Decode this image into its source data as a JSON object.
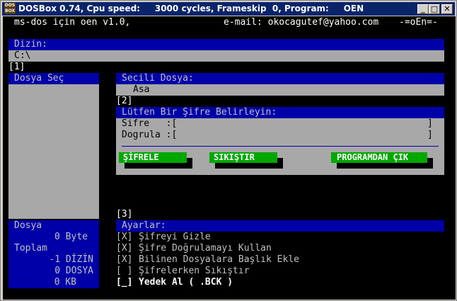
{
  "window": {
    "title": "DOSBox 0.74, Cpu speed:     3000 cycles, Frameskip  0, Program:     OEN",
    "icon_text": "DOS BOX",
    "minimize": "_",
    "maximize": "□",
    "close": "✕"
  },
  "header": {
    "app": "ms-dos için oen v1.0,",
    "email": "e-mail: okocagutef@yahoo.com",
    "logo": "-=oEn=-"
  },
  "dir": {
    "label": "Dizin:",
    "path": "C:\\",
    "index": "[1]"
  },
  "file_select": {
    "label": "Dosya Seç"
  },
  "selected": {
    "label": "Secili Dosya:",
    "name": "Asa",
    "index": "[2]"
  },
  "password": {
    "label": "Lütfen Bir Şifre Belirleyin:",
    "pass_label": "Sifre   :[",
    "confirm_label": "Dogrula :[",
    "bracket_close": "]"
  },
  "buttons": {
    "encrypt": "ŞİFRELE",
    "compress": "SIKIŞTIR",
    "exit": "PROGRAMDAN ÇIK"
  },
  "index3": "[3]",
  "stats": {
    "file_label": "Dosya",
    "file_bytes": "0 Byte",
    "total_label": "Toplam",
    "dirs": "-1 DİZİN",
    "files": "0 DOSYA",
    "kb": "0 KB"
  },
  "settings": {
    "label": "Ayarlar:",
    "items": [
      {
        "box": "[X]",
        "text": "Şifreyi Gizle"
      },
      {
        "box": "[X]",
        "text": "Şifre Doğrulamayı Kullan"
      },
      {
        "box": "[X]",
        "text": "Bilinen Dosyalara Başlık Ekle"
      },
      {
        "box": "[ ]",
        "text": "Şifrelerken Sıkıştır"
      },
      {
        "box": "[_]",
        "text": "Yedek Al ( .BCK )"
      }
    ]
  },
  "colors": {
    "bar_blue": "#0000a8",
    "panel_gray": "#a8a8a8",
    "button_green": "#00a800",
    "title_blue": "#0a246a"
  }
}
